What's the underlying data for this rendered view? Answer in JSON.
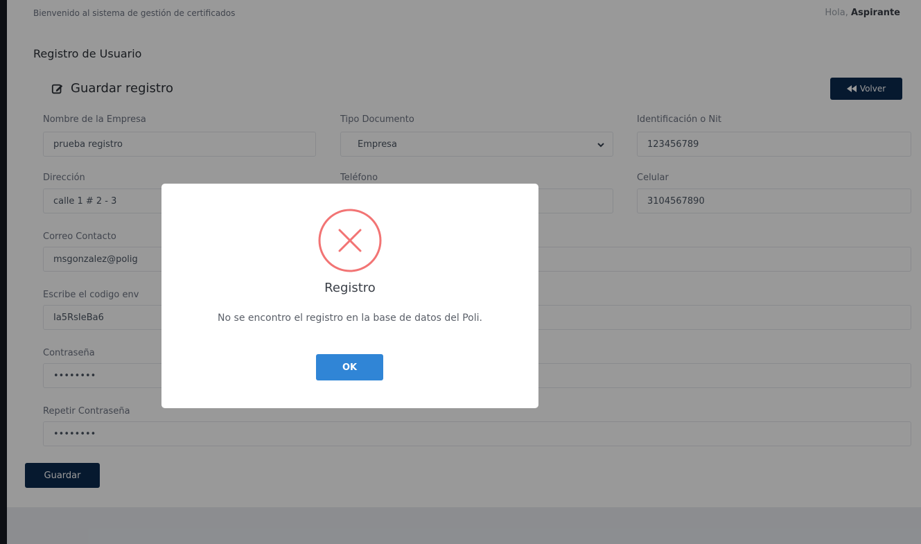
{
  "header": {
    "welcome": "Bienvenido al sistema de gestión de certificados",
    "greeting_prefix": "Hola, ",
    "user": "Aspirante"
  },
  "page": {
    "title": "Registro de Usuario"
  },
  "card": {
    "title": "Guardar registro",
    "back_label": "Volver"
  },
  "form": {
    "empresa": {
      "label": "Nombre de la Empresa",
      "value": "prueba registro"
    },
    "tipo_documento": {
      "label": "Tipo Documento",
      "value": "Empresa"
    },
    "identificacion": {
      "label": "Identificación o Nit",
      "value": "123456789"
    },
    "direccion": {
      "label": "Dirección",
      "value": "calle 1 # 2 - 3"
    },
    "telefono": {
      "label": "Teléfono",
      "value": ""
    },
    "celular": {
      "label": "Celular",
      "value": "3104567890"
    },
    "correo": {
      "label": "Correo Contacto",
      "value": "msgonzalez@polig"
    },
    "codigo": {
      "label": "Escribe el codigo env",
      "value": "Ia5RsIeBa6"
    },
    "contrasena": {
      "label": "Contraseña",
      "value": "••••••••"
    },
    "repetir_contrasena": {
      "label": "Repetir Contraseña",
      "value": "••••••••"
    },
    "save_label": "Guardar"
  },
  "modal": {
    "title": "Registro",
    "message": "No se encontro el registro en la base de datos del Poli.",
    "ok_label": "OK"
  },
  "colors": {
    "primary_dark": "#0b2a4f",
    "error": "#f27474",
    "ok_button": "#3085d6"
  },
  "icons": {
    "card_title": "edit-icon",
    "back": "backward-icon",
    "select": "chevron-down-icon",
    "modal": "error-x-icon"
  }
}
